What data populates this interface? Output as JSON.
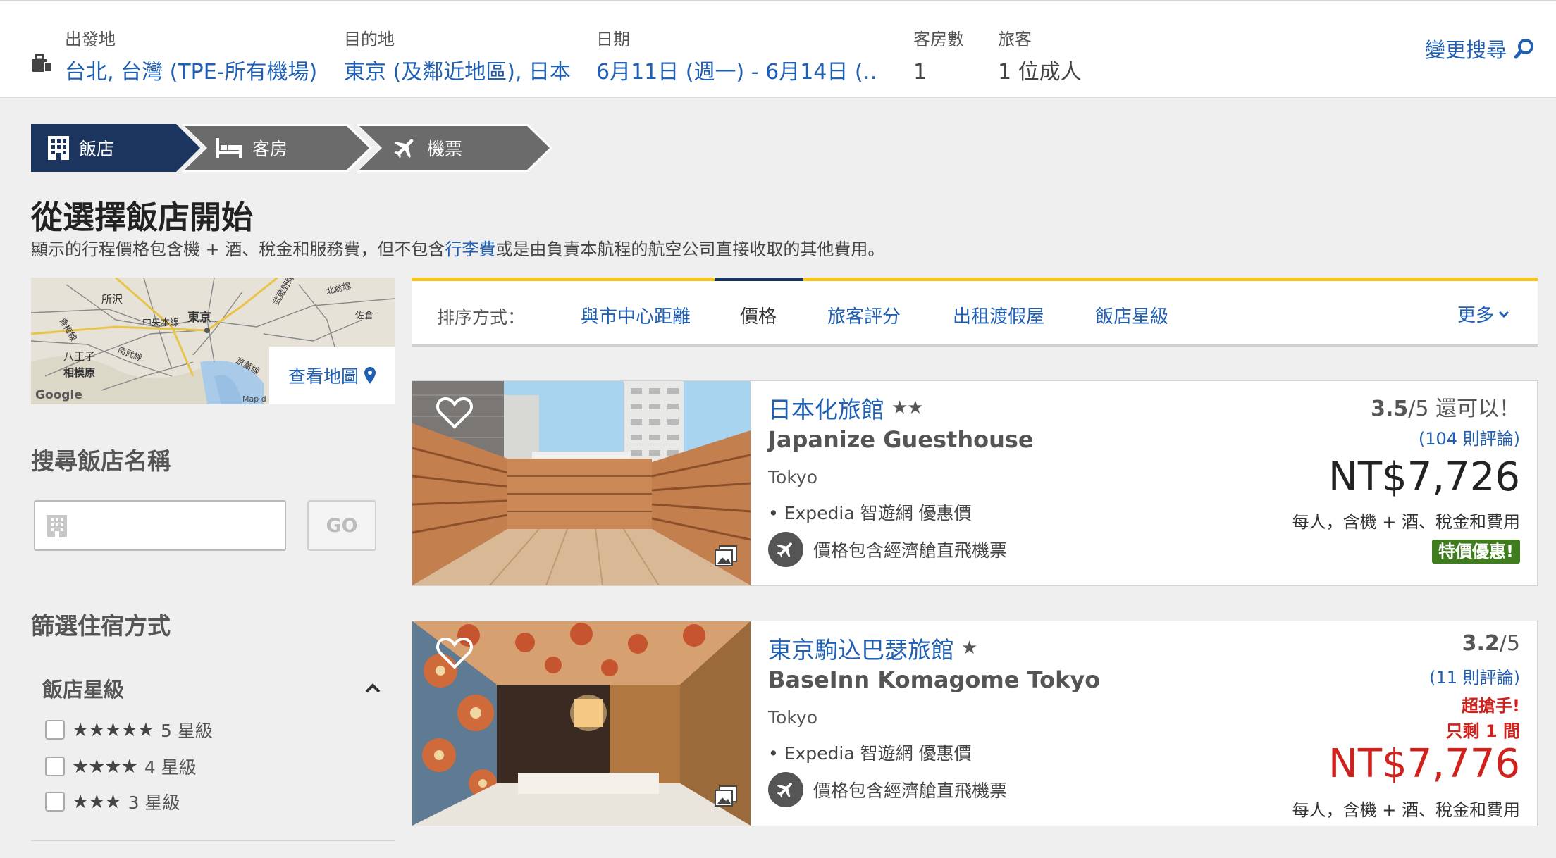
{
  "search": {
    "origin_label": "出發地",
    "origin_value": "台北, 台灣 (TPE-所有機場)",
    "dest_label": "目的地",
    "dest_value": "東京 (及鄰近地區), 日本",
    "date_label": "日期",
    "date_value": "6月11日 (週一) - 6月14日 (…",
    "rooms_label": "客房數",
    "rooms_value": "1",
    "guests_label": "旅客",
    "guests_value": "1 位成人",
    "change_label": "變更搜尋"
  },
  "steps": [
    {
      "label": "飯店",
      "icon": "building-icon",
      "active": true
    },
    {
      "label": "客房",
      "icon": "bed-icon",
      "active": false
    },
    {
      "label": "機票",
      "icon": "airplane-icon",
      "active": false
    }
  ],
  "headline": "從選擇飯店開始",
  "note": {
    "before": "顯示的行程價格包含機 + 酒、稅金和服務費，但不包含",
    "link": "行李費",
    "after": "或是由負責本航程的航空公司直接收取的其他費用。"
  },
  "map": {
    "button_label": "查看地圖",
    "labels": {
      "tokyo": "東京",
      "sagamihara": "相模原",
      "hachioji": "八王子",
      "tokorozawa": "所沢",
      "chuo": "中央本線",
      "ome": "青梅線",
      "nambu": "南武線",
      "kitasobu": "北総線",
      "sakura": "佐倉",
      "keiyo": "京葉線",
      "musashino": "武蔵野線",
      "google": "Google",
      "mapdata": "Map d"
    }
  },
  "sidebar": {
    "search_name_title": "搜尋飯店名稱",
    "go_label": "GO",
    "filter_title": "篩選住宿方式",
    "star_filter_title": "飯店星級",
    "star_options": [
      {
        "stars": "★★★★★",
        "label": "5 星級"
      },
      {
        "stars": "★★★★",
        "label": "4 星級"
      },
      {
        "stars": "★★★",
        "label": "3 星級"
      }
    ]
  },
  "sort": {
    "label": "排序方式：",
    "options": [
      "與市中心距離",
      "價格",
      "旅客評分",
      "出租渡假屋",
      "飯店星級"
    ],
    "active": "價格",
    "more_label": "更多"
  },
  "hotels": [
    {
      "name": "日本化旅館",
      "stars": "★★",
      "en_name": "Japanize Guesthouse",
      "city": "Tokyo",
      "deal": "• Expedia 智遊網 優惠價",
      "flight_note": "價格包含經濟艙直飛機票",
      "rating_score": "3.5",
      "rating_suffix": "/5 還可以！",
      "reviews": "(104 則評論)",
      "price": "NT$7,726",
      "price_note": "每人，含機 + 酒、稅金和費用",
      "badge": "特價優惠!"
    },
    {
      "name": "東京駒込巴瑟旅館",
      "stars": "★",
      "en_name": "BaseInn Komagome Tokyo",
      "city": "Tokyo",
      "deal": "• Expedia 智遊網 優惠價",
      "flight_note": "價格包含經濟艙直飛機票",
      "rating_score": "3.2",
      "rating_suffix": "/5",
      "reviews": "(11 則評論)",
      "urgent_1": "超搶手!",
      "urgent_2": "只剩 1 間",
      "price": "NT$7,776",
      "price_note": "每人，含機 + 酒、稅金和費用"
    }
  ],
  "colors": {
    "link": "#1f5fb4",
    "nav_active": "#1b355e",
    "nav_inactive": "#6b6b6b",
    "accent_yellow": "#f7c51d",
    "deal_green": "#3f7c1d",
    "urgent_red": "#d0211c"
  }
}
